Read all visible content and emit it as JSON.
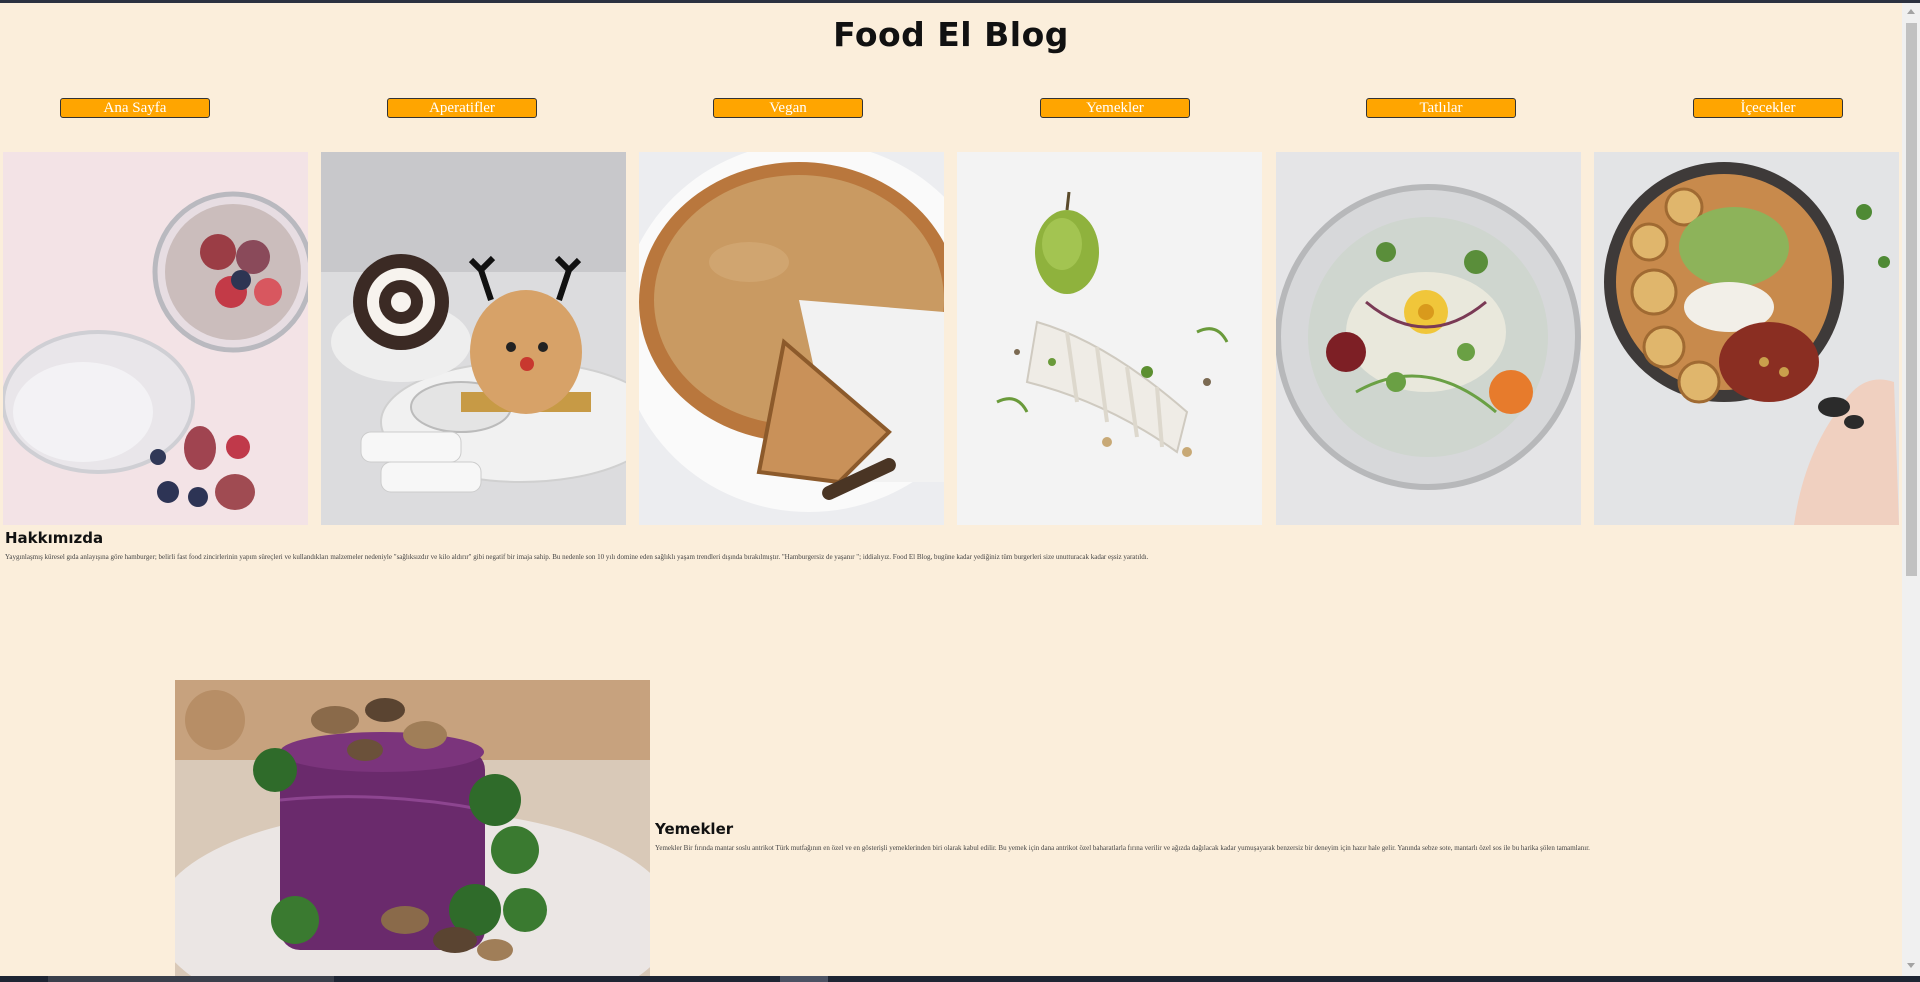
{
  "site": {
    "title": "Food El Blog"
  },
  "nav": {
    "items": [
      {
        "label": "Ana Sayfa"
      },
      {
        "label": "Aperatifler"
      },
      {
        "label": "Vegan"
      },
      {
        "label": "Yemekler"
      },
      {
        "label": "Tatlılar"
      },
      {
        "label": "İçecekler"
      }
    ]
  },
  "gallery": {
    "images": [
      {
        "subject": "chia pudding with figs"
      },
      {
        "subject": "reindeer dessert and cake roll"
      },
      {
        "subject": "pie with missing slice"
      },
      {
        "subject": "pear and vegetable plate"
      },
      {
        "subject": "salad in glass bowl"
      },
      {
        "subject": "potato and guacamole bowl"
      }
    ]
  },
  "about": {
    "title": "Hakkımızda",
    "text": "Yaygınlaşmış küresel gıda anlayışına göre hamburger; belirli fast food zincirlerinin yapım süreçleri ve kullandıkları malzemeler nedeniyle \"sağlıksızdır ve kilo aldırır\" gibi negatif bir imaja sahip. Bu nedenle son 10 yılı domine eden sağlıklı yaşam trendleri dışında bırakılmıştır. \"Hamburgersiz de yaşanır \"; iddialıyız. Food El Blog, bugüne kadar yediğiniz tüm burgerleri size unutturacak kadar eşsiz yaratıldı."
  },
  "feature": {
    "title": "Yemekler",
    "text": "Yemekler Bir fırında mantar soslu antrikot Türk mutfağının en özel ve en gösterişli yemeklerinden biri olarak kabul edilir. Bu yemek için dana antrikot özel baharatlarla fırına verilir ve ağızda dağılacak kadar yumuşayarak benzersiz bir deneyim için hazır hale gelir. Yanında sebze sote, mantarlı özel sos ile bu harika şölen tamamlanır.",
    "image_subject": "purple mash with mushrooms and kale"
  },
  "colors": {
    "background": "#fbeedb",
    "nav_button": "#ffa500",
    "nav_text": "#ffffff"
  }
}
